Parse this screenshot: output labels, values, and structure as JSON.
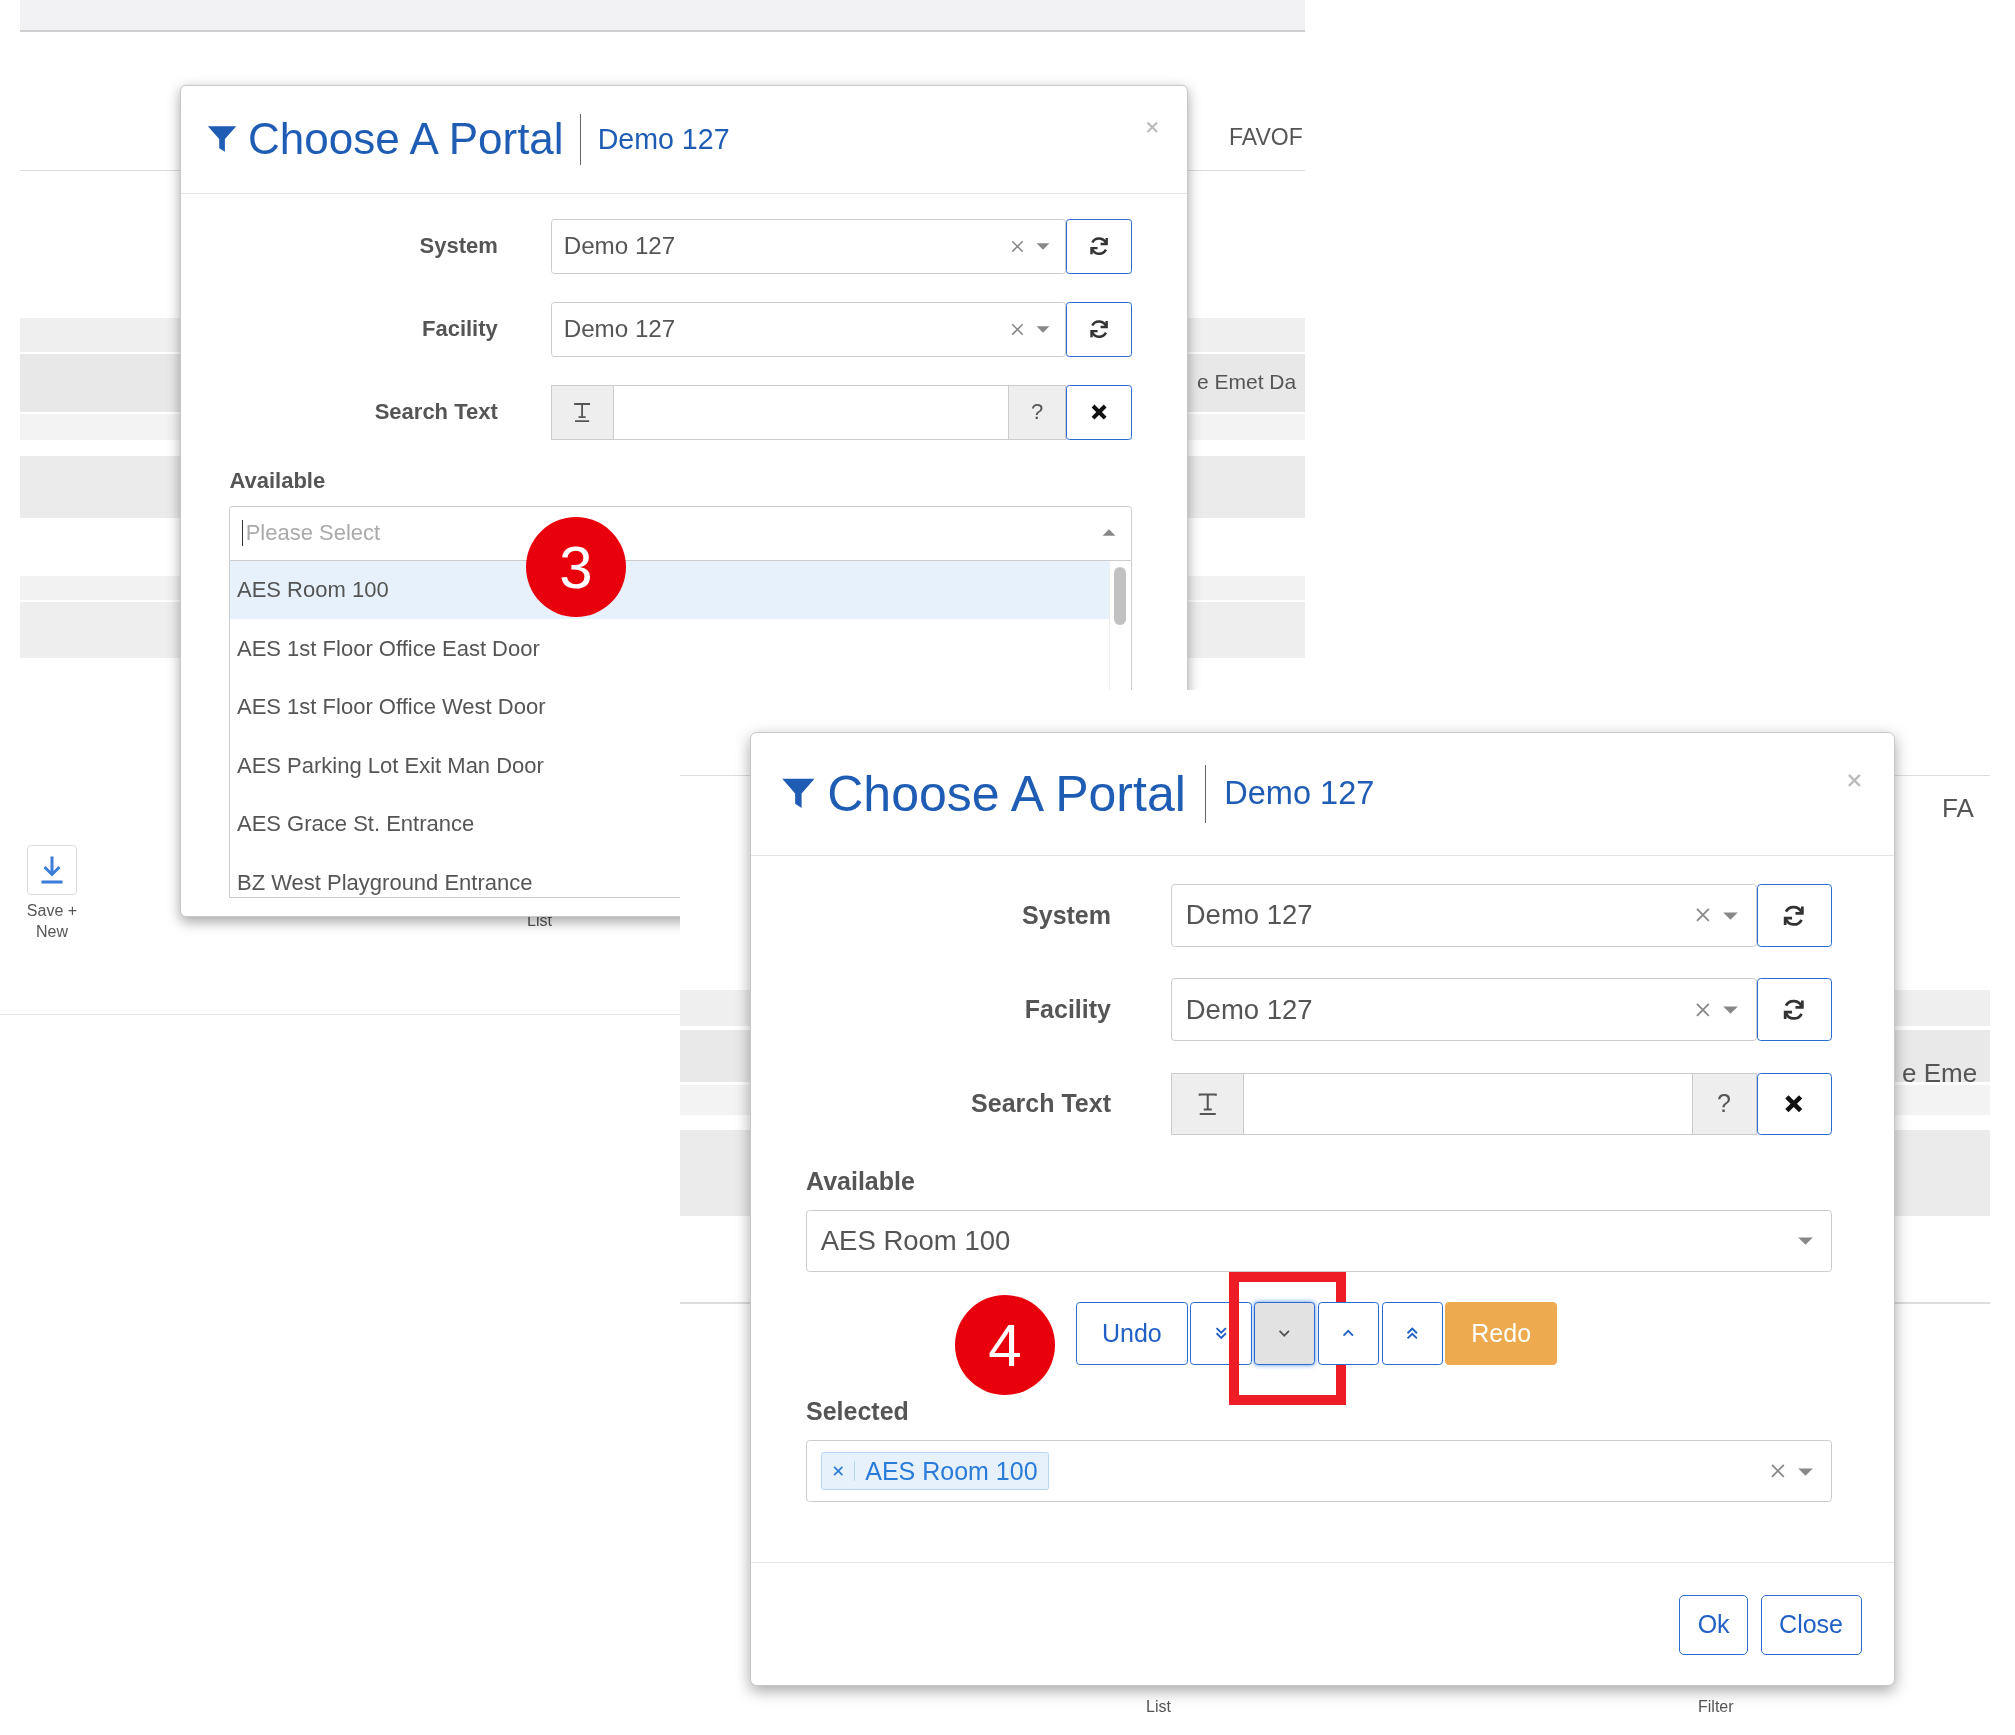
{
  "screenshots": [
    {
      "background": {
        "texts": [
          {
            "kind": "header",
            "text": "FAVOF"
          },
          {
            "kind": "column",
            "text": "e Emet Da"
          },
          {
            "kind": "footer",
            "text": "List"
          }
        ],
        "toolbar_button": {
          "label": "Save + New"
        }
      },
      "dialog": {
        "title": "Choose A Portal",
        "subtitle": "Demo 127",
        "fields": [
          {
            "kind": "select",
            "label": "System",
            "value": "Demo 127"
          },
          {
            "kind": "select",
            "label": "Facility",
            "value": "Demo 127"
          },
          {
            "kind": "search",
            "label": "Search Text",
            "help": "?"
          }
        ],
        "available": {
          "label": "Available",
          "open": true,
          "placeholder": "Please Select",
          "options": [
            {
              "text": "AES Room 100",
              "selected": true
            },
            {
              "text": "AES 1st Floor Office East Door",
              "selected": false
            },
            {
              "text": "AES 1st Floor Office West Door",
              "selected": false
            },
            {
              "text": "AES Parking Lot Exit Man Door",
              "selected": false
            },
            {
              "text": "AES Grace St. Entrance",
              "selected": false
            },
            {
              "text": "BZ West Playground Entrance",
              "selected": false
            }
          ]
        },
        "badge": "3"
      }
    },
    {
      "background": {
        "texts": [
          {
            "kind": "header",
            "text": "FA"
          },
          {
            "kind": "column",
            "text": "e Eme"
          },
          {
            "kind": "footer",
            "text": "List"
          },
          {
            "kind": "footer",
            "text": "Filter"
          }
        ]
      },
      "dialog": {
        "title": "Choose A Portal",
        "subtitle": "Demo 127",
        "fields": [
          {
            "kind": "select",
            "label": "System",
            "value": "Demo 127"
          },
          {
            "kind": "select",
            "label": "Facility",
            "value": "Demo 127"
          },
          {
            "kind": "search",
            "label": "Search Text",
            "help": "?"
          }
        ],
        "available": {
          "label": "Available",
          "open": false,
          "value": "AES Room 100"
        },
        "move_buttons": [
          {
            "kind": "undo",
            "label": "Undo",
            "pressed": false,
            "highlighted": false
          },
          {
            "kind": "bottom",
            "pressed": false,
            "highlighted": false
          },
          {
            "kind": "down",
            "pressed": true,
            "highlighted": true
          },
          {
            "kind": "up",
            "pressed": false,
            "highlighted": false
          },
          {
            "kind": "top",
            "pressed": false,
            "highlighted": false
          },
          {
            "kind": "redo",
            "label": "Redo",
            "pressed": false,
            "highlighted": false
          }
        ],
        "selected": {
          "label": "Selected",
          "tags": [
            "AES Room 100"
          ]
        },
        "footer_buttons": [
          "Ok",
          "Close"
        ],
        "badge": "4"
      }
    }
  ]
}
